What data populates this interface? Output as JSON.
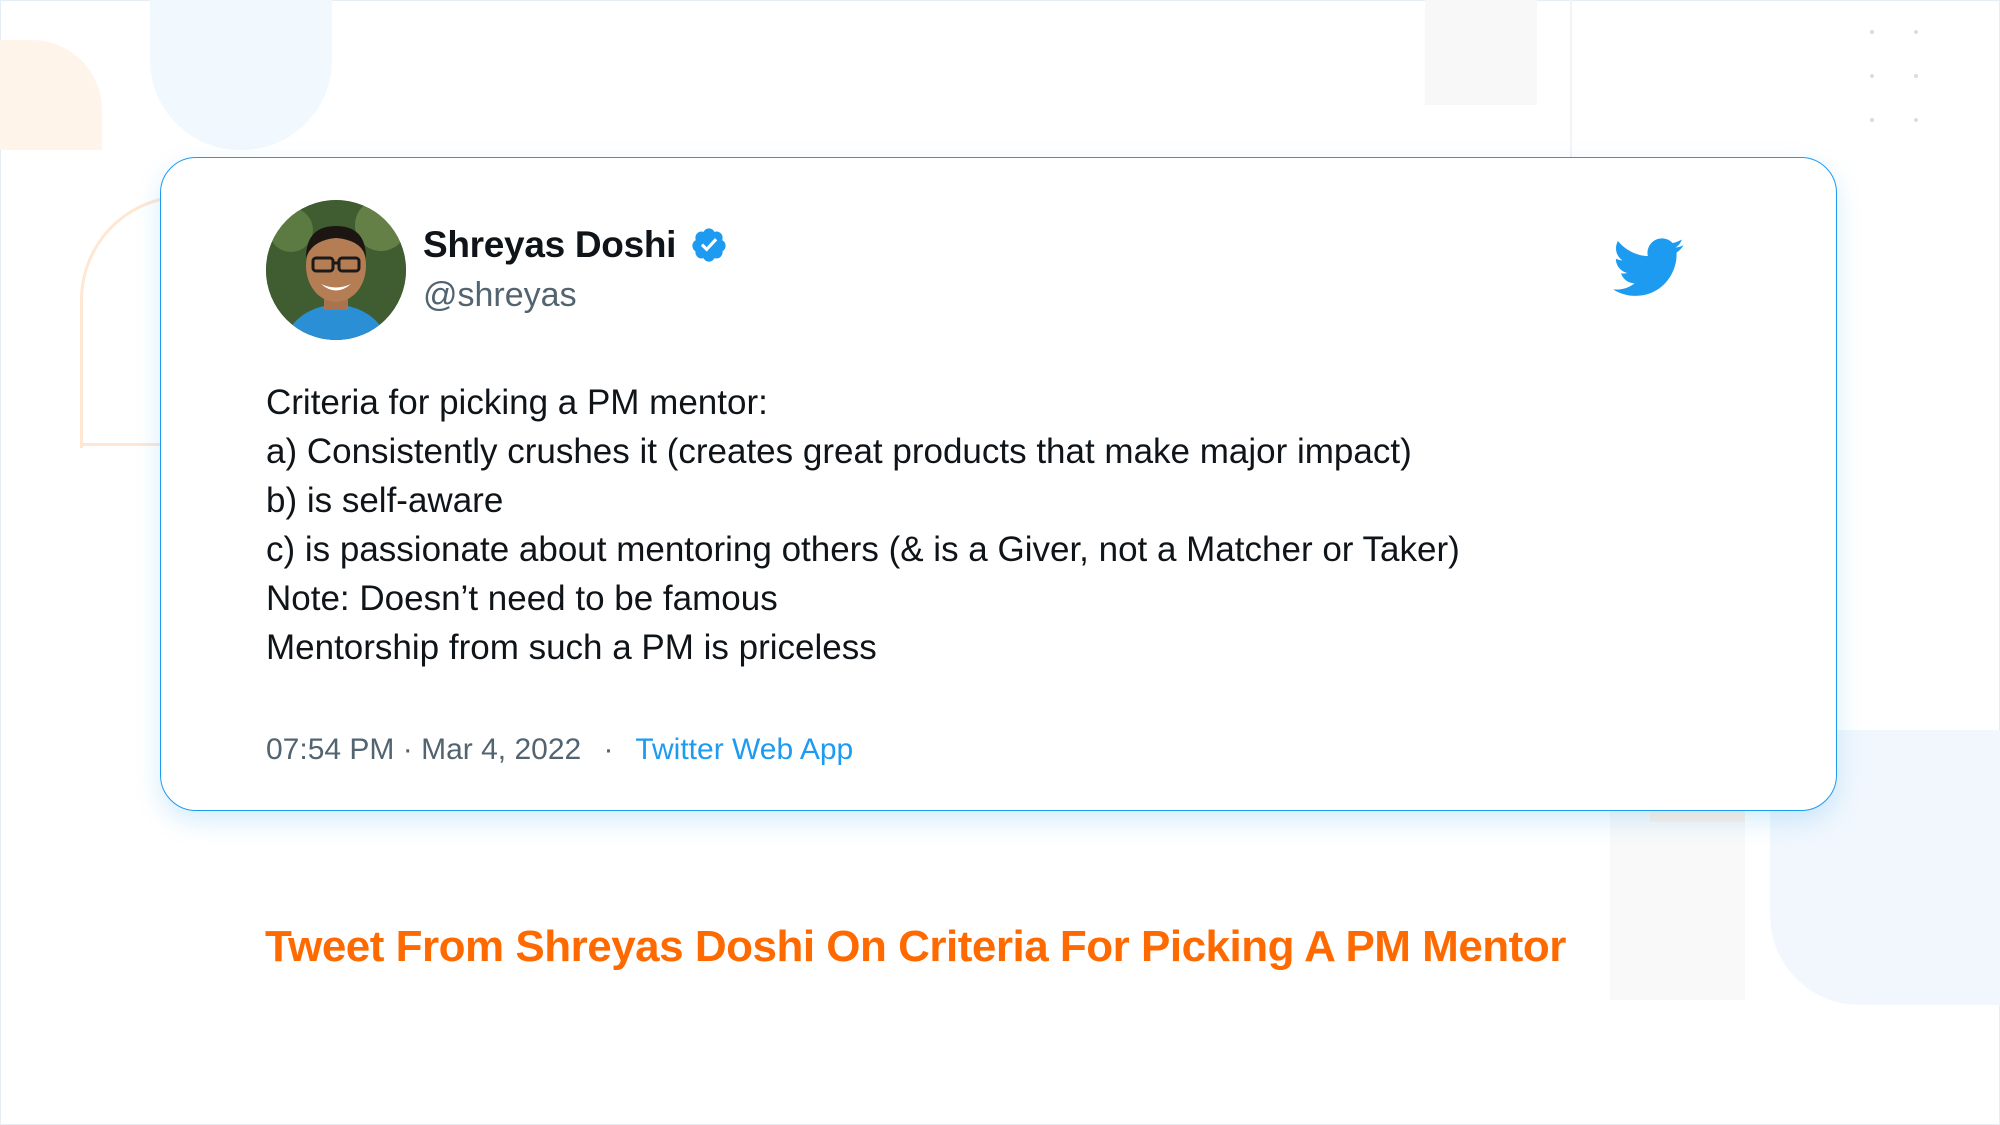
{
  "tweet": {
    "author_name": "Shreyas Doshi",
    "author_handle": "@shreyas",
    "lines": [
      "Criteria for picking a PM mentor:",
      "a) Consistently crushes it (creates great products that make major impact)",
      "b) is self-aware",
      "c) is passionate about mentoring others (& is a Giver, not a Matcher or Taker)",
      "Note: Doesn’t need to be famous",
      "Mentorship from such a PM is priceless"
    ],
    "time": "07:54 PM",
    "date": "Mar 4, 2022",
    "dot_separator": "·",
    "source": "Twitter Web App",
    "verified": true
  },
  "caption": "Tweet From Shreyas Doshi On Criteria For Picking A PM Mentor",
  "icons": {
    "verified": "verified-badge-icon",
    "twitter": "twitter-bird-icon",
    "avatar": "profile-photo"
  },
  "colors": {
    "accent_blue": "#1d9bf0",
    "caption_orange": "#ff6a00",
    "text_primary": "#0f1419",
    "text_secondary": "#536471"
  }
}
